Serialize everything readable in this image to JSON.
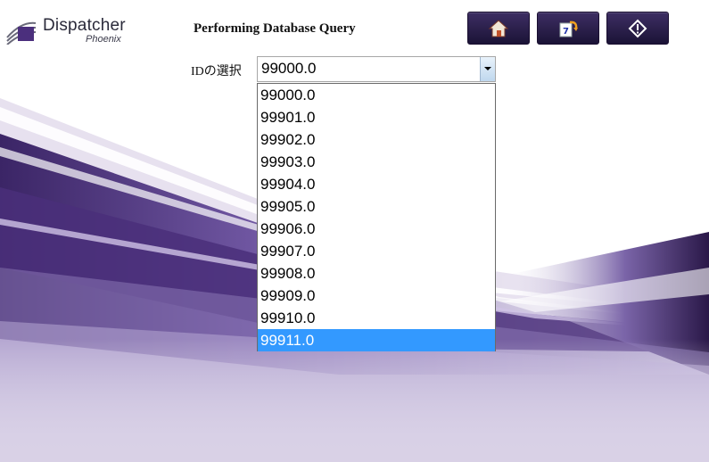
{
  "app": {
    "logo_title": "Dispatcher",
    "logo_subtitle": "Phoenix"
  },
  "header": {
    "title": "Performing Database Query"
  },
  "toolbar": {
    "buttons": [
      {
        "icon": "home-icon"
      },
      {
        "icon": "restart-icon"
      },
      {
        "icon": "info-icon"
      }
    ]
  },
  "form": {
    "id_label": "IDの選択",
    "id_select": {
      "value": "99000.0",
      "options": [
        "99000.0",
        "99901.0",
        "99902.0",
        "99903.0",
        "99904.0",
        "99905.0",
        "99906.0",
        "99907.0",
        "99908.0",
        "99909.0",
        "99910.0",
        "99911.0"
      ],
      "highlighted": "99911.0"
    }
  },
  "colors": {
    "accent": "#3399ff",
    "button_bg": "#2b1f4a",
    "background_purple": "#5a3f8c"
  }
}
